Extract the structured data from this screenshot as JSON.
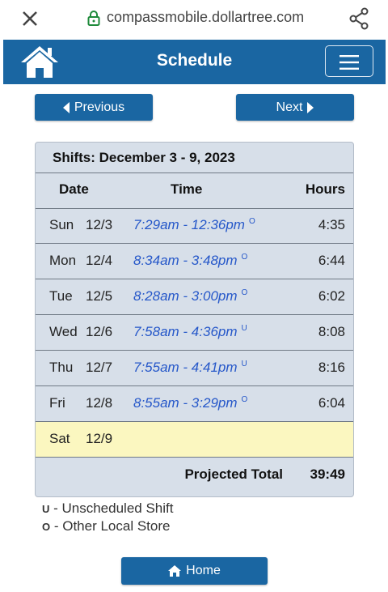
{
  "browser": {
    "url": "compassmobile.dollartree.com"
  },
  "header": {
    "title": "Schedule"
  },
  "nav": {
    "previous_label": "Previous",
    "next_label": "Next"
  },
  "shifts": {
    "caption": "Shifts: December 3 - 9, 2023",
    "columns": {
      "date": "Date",
      "time": "Time",
      "hours": "Hours"
    },
    "rows": [
      {
        "day": "Sun",
        "date": "12/3",
        "time": "7:29am - 12:36pm",
        "flag": "O",
        "hours": "4:35"
      },
      {
        "day": "Mon",
        "date": "12/4",
        "time": "8:34am - 3:48pm",
        "flag": "O",
        "hours": "6:44"
      },
      {
        "day": "Tue",
        "date": "12/5",
        "time": "8:28am - 3:00pm",
        "flag": "O",
        "hours": "6:02"
      },
      {
        "day": "Wed",
        "date": "12/6",
        "time": "7:58am - 4:36pm",
        "flag": "U",
        "hours": "8:08"
      },
      {
        "day": "Thu",
        "date": "12/7",
        "time": "7:55am - 4:41pm",
        "flag": "U",
        "hours": "8:16"
      },
      {
        "day": "Fri",
        "date": "12/8",
        "time": "8:55am - 3:29pm",
        "flag": "O",
        "hours": "6:04"
      },
      {
        "day": "Sat",
        "date": "12/9",
        "time": "",
        "flag": "",
        "hours": ""
      }
    ],
    "total_label": "Projected Total",
    "total_value": "39:49"
  },
  "legend": [
    {
      "code": "U",
      "text": " - Unscheduled Shift"
    },
    {
      "code": "O",
      "text": " - Other Local Store"
    }
  ],
  "footer": {
    "home_label": "Home"
  },
  "colors": {
    "brand": "#1a66a2",
    "table_bg": "#d7dfe9",
    "today_highlight": "#fbf7c0",
    "shift_time": "#2557c9"
  }
}
